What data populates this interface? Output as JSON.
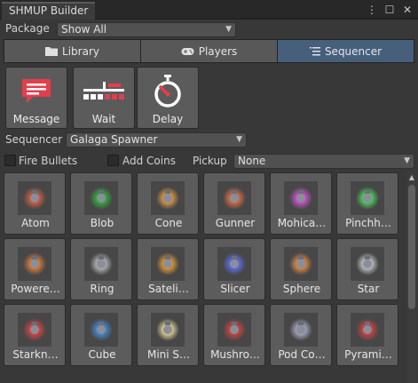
{
  "window": {
    "title": "SHMUP Builder"
  },
  "package": {
    "label": "Package",
    "value": "Show All"
  },
  "tabs": [
    {
      "label": "Library",
      "icon": "folder-icon"
    },
    {
      "label": "Players",
      "icon": "gamepad-icon"
    },
    {
      "label": "Sequencer",
      "icon": "list-icon",
      "active": true
    }
  ],
  "actions": [
    {
      "label": "Message",
      "icon": "message-icon"
    },
    {
      "label": "Wait",
      "icon": "wait-icon"
    },
    {
      "label": "Delay",
      "icon": "stopwatch-icon"
    }
  ],
  "sequencer": {
    "label": "Sequencer",
    "value": "Galaga Spawner"
  },
  "options": {
    "fire_bullets": "Fire Bullets",
    "add_coins": "Add Coins",
    "pickup_label": "Pickup",
    "pickup_value": "None"
  },
  "enemies": [
    {
      "label": "Atom",
      "glow": "#e06040"
    },
    {
      "label": "Blob",
      "glow": "#2fbf3a"
    },
    {
      "label": "Cone",
      "glow": "#f0a040"
    },
    {
      "label": "Gunner",
      "glow": "#f07040"
    },
    {
      "label": "Mohica…",
      "glow": "#e050e0"
    },
    {
      "label": "Pinchh…",
      "glow": "#50e060"
    },
    {
      "label": "Powere…",
      "glow": "#f08030"
    },
    {
      "label": "Ring",
      "glow": "#c0c0c0"
    },
    {
      "label": "Sateli…",
      "glow": "#f0a030"
    },
    {
      "label": "Slicer",
      "glow": "#6070ff"
    },
    {
      "label": "Sphere",
      "glow": "#f09040"
    },
    {
      "label": "Star",
      "glow": "#d0d0d0"
    },
    {
      "label": "Starkn…",
      "glow": "#f04040"
    },
    {
      "label": "Cube",
      "glow": "#4090e0"
    },
    {
      "label": "Mini S…",
      "glow": "#f0e0a0"
    },
    {
      "label": "Mushro…",
      "glow": "#e04040"
    },
    {
      "label": "Pod Co…",
      "glow": "#b0b0d0"
    },
    {
      "label": "Pyrami…",
      "glow": "#e04040"
    }
  ],
  "colors": {
    "accent_tab": "#46607c",
    "message_red": "#e33e4c",
    "panel_bg": "#383838"
  }
}
